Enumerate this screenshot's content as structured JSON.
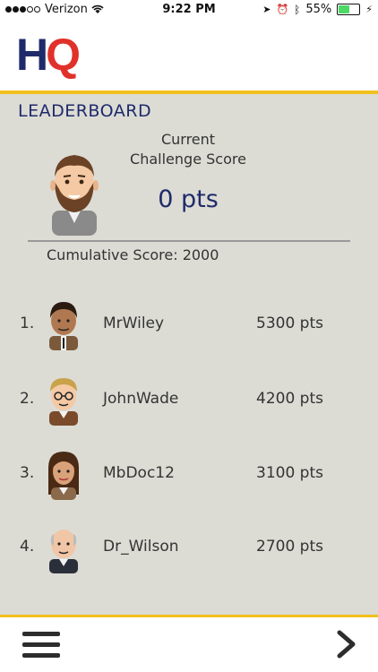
{
  "status_bar": {
    "carrier": "Verizon",
    "time": "9:22 PM",
    "battery": "55%",
    "battery_level": 0.55
  },
  "app": {
    "logo_h": "H",
    "logo_q": "Q"
  },
  "leaderboard": {
    "title": "LEADERBOARD",
    "current_label_1": "Current",
    "current_label_2": "Challenge Score",
    "current_score": "0 pts",
    "cumulative": "Cumulative Score: 2000",
    "entries": [
      {
        "rank": "1.",
        "name": "MrWiley",
        "points": "5300 pts",
        "avatar": "male-avatar-icon"
      },
      {
        "rank": "2.",
        "name": "JohnWade",
        "points": "4200 pts",
        "avatar": "glasses-avatar-icon"
      },
      {
        "rank": "3.",
        "name": "MbDoc12",
        "points": "3100 pts",
        "avatar": "female-avatar-icon"
      },
      {
        "rank": "4.",
        "name": "Dr_Wilson",
        "points": "2700 pts",
        "avatar": "bald-avatar-icon"
      }
    ]
  },
  "footer": {
    "menu_icon": "hamburger-menu-icon",
    "next_icon": "chevron-right-icon"
  },
  "colors": {
    "accent": "#f2c01e",
    "navy": "#1f2a6b",
    "red": "#e0312a",
    "panel": "#dcdcd5"
  }
}
